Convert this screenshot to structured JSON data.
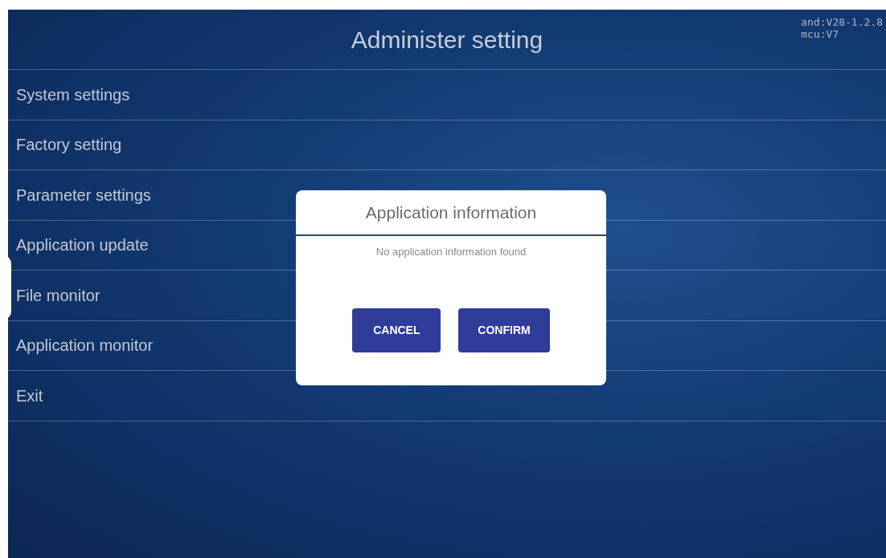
{
  "header": {
    "title": "Administer setting",
    "versions": [
      "and:V28-1.2.8",
      "mcu:V7"
    ]
  },
  "menu": [
    {
      "label": "System settings"
    },
    {
      "label": "Factory setting"
    },
    {
      "label": "Parameter settings"
    },
    {
      "label": "Application update"
    },
    {
      "label": "File monitor"
    },
    {
      "label": "Application monitor"
    },
    {
      "label": "Exit"
    }
  ],
  "dialog": {
    "title": "Application information",
    "message": "No application information found",
    "buttons": [
      "CANCEL",
      "CONFIRM"
    ]
  }
}
